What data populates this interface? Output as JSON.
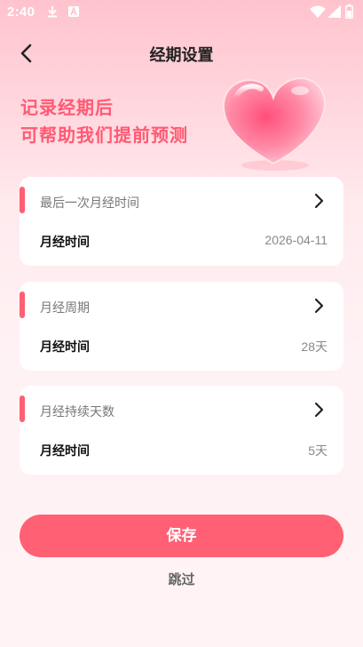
{
  "status_bar": {
    "time": "2:40",
    "icons": [
      "download-icon",
      "a-notification-icon",
      "wifi-icon",
      "signal-icon",
      "battery-icon"
    ]
  },
  "header": {
    "back_icon": "chevron-left-icon",
    "title": "经期设置"
  },
  "hero": {
    "line1": "记录经期后",
    "line2": "可帮助我们提前预测",
    "image": "heart-icon"
  },
  "cards": [
    {
      "label": "最后一次月经时间",
      "sublabel": "月经时间",
      "value": "2026-04-11"
    },
    {
      "label": "月经周期",
      "sublabel": "月经时间",
      "value": "28天"
    },
    {
      "label": "月经持续天数",
      "sublabel": "月经时间",
      "value": "5天"
    }
  ],
  "actions": {
    "save_label": "保存",
    "skip_label": "跳过"
  },
  "colors": {
    "accent": "#ff6074",
    "slogan": "#ff5a73",
    "background_top": "#ffc3cd",
    "background_bottom": "#fff3f5"
  }
}
